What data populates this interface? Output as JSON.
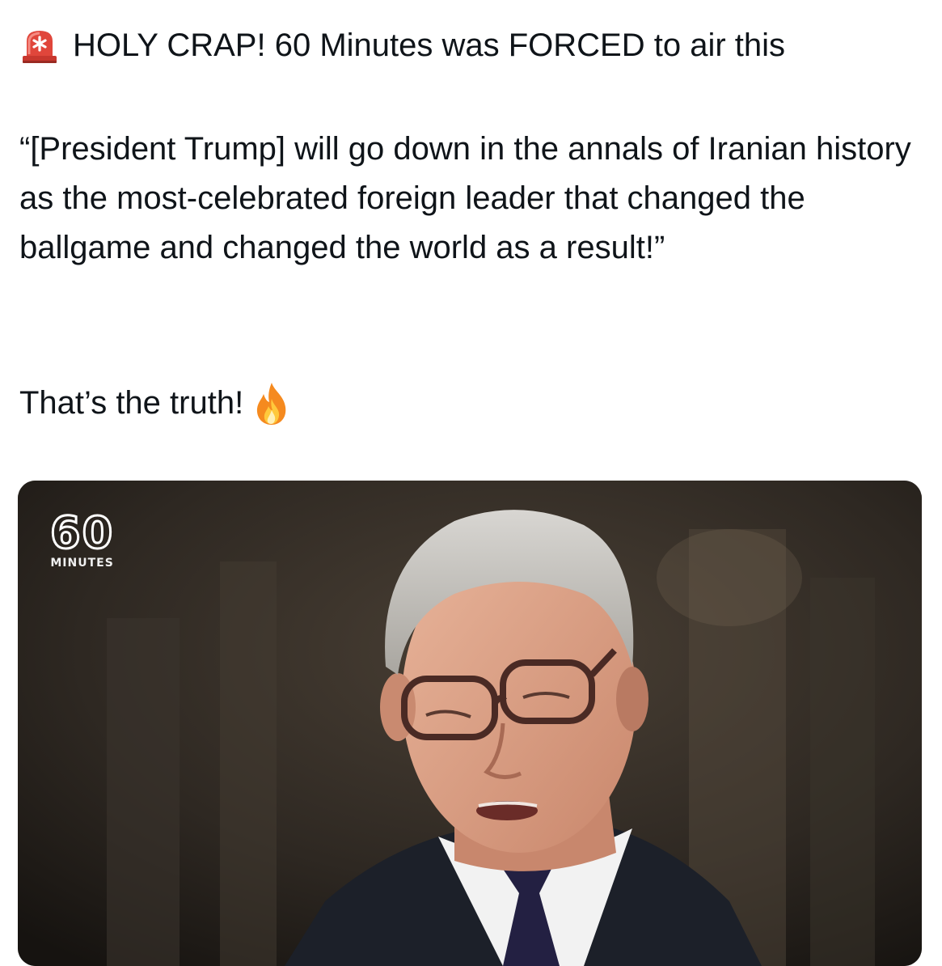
{
  "post": {
    "headline_icon": "siren-icon",
    "headline": "HOLY CRAP! 60 Minutes was FORCED to air this",
    "quote": "“[President Trump] will go down in the annals of Iranian history as the most-celebrated foreign leader that changed the ballgame and changed the world as a result!”",
    "closing": "That’s the truth!",
    "closing_icon": "fire-icon"
  },
  "media": {
    "logo_number": "60",
    "logo_word": "MINUTES"
  },
  "colors": {
    "text": "#0f1419",
    "siren_red": "#e0463b",
    "fire_orange": "#f58a1f",
    "video_bg": "#2a2520"
  }
}
